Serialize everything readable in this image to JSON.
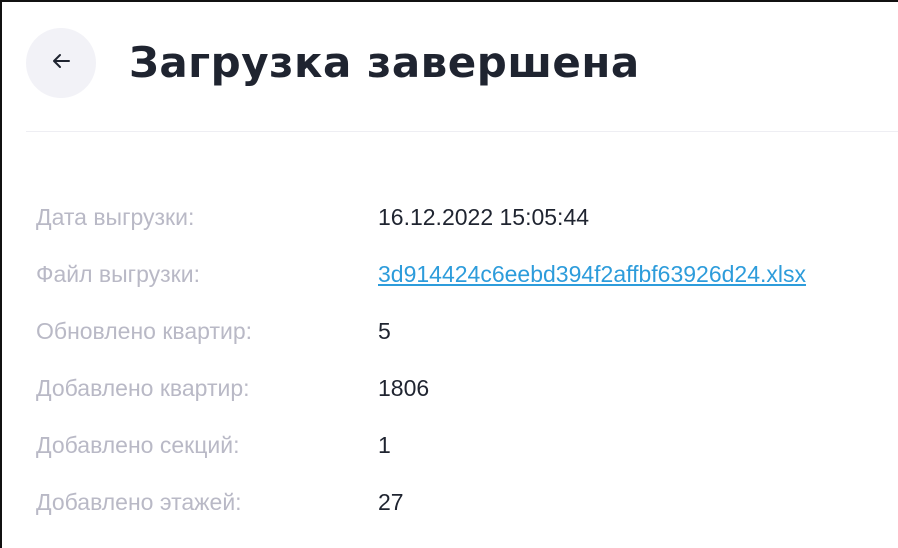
{
  "header": {
    "back_icon": "arrow-left-icon",
    "title": "Загрузка завершена"
  },
  "details": [
    {
      "label": "Дата выгрузки:",
      "value": "16.12.2022 15:05:44"
    },
    {
      "label": "Файл выгрузки:",
      "value": "3d914424c6eebd394f2affbf63926d24.xlsx",
      "is_link": true
    },
    {
      "label": "Обновлено квартир:",
      "value": "5"
    },
    {
      "label": "Добавлено квартир:",
      "value": "1806"
    },
    {
      "label": "Добавлено секций:",
      "value": "1"
    },
    {
      "label": "Добавлено этажей:",
      "value": "27"
    }
  ],
  "colors": {
    "title": "#1f2430",
    "label": "#b9b9c6",
    "value": "#1f2430",
    "link": "#2d9cdb",
    "back_button_bg": "#f2f2f7",
    "divider": "#eeeef3"
  }
}
